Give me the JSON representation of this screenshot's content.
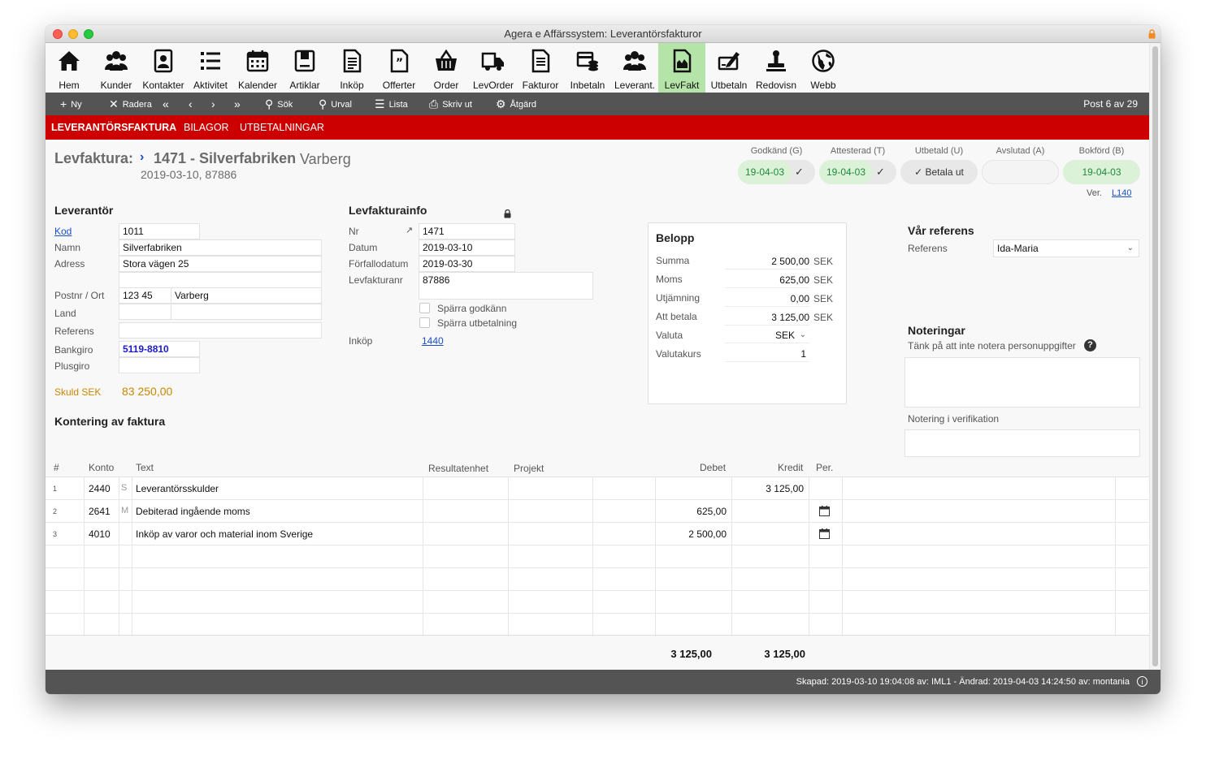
{
  "window": {
    "title": "Agera e Affärssystem: Leverantörsfakturor"
  },
  "toolbar": {
    "items": [
      {
        "label": "Hem",
        "icon": "home-icon"
      },
      {
        "label": "Kunder",
        "icon": "customers-icon"
      },
      {
        "label": "Kontakter",
        "icon": "contacts-icon"
      },
      {
        "label": "Aktivitet",
        "icon": "activity-list-icon"
      },
      {
        "label": "Kalender",
        "icon": "calendar-icon"
      },
      {
        "label": "Artiklar",
        "icon": "articles-icon"
      },
      {
        "label": "Inköp",
        "icon": "purchase-icon"
      },
      {
        "label": "Offerter",
        "icon": "quotes-icon"
      },
      {
        "label": "Order",
        "icon": "basket-icon"
      },
      {
        "label": "LevOrder",
        "icon": "truck-icon"
      },
      {
        "label": "Fakturor",
        "icon": "invoices-icon"
      },
      {
        "label": "Inbetaln",
        "icon": "incoming-payment-icon"
      },
      {
        "label": "Leverant.",
        "icon": "suppliers-icon"
      },
      {
        "label": "LevFakt",
        "icon": "supplier-invoice-icon"
      },
      {
        "label": "Utbetaln",
        "icon": "outgoing-payment-icon"
      },
      {
        "label": "Redovisn",
        "icon": "stamp-icon"
      },
      {
        "label": "Webb",
        "icon": "globe-icon"
      }
    ],
    "active": "LevFakt",
    "active_color": "#b5e4a8"
  },
  "actions": {
    "new": "Ny",
    "delete": "Radera",
    "search": "Sök",
    "filter": "Urval",
    "list": "Lista",
    "print": "Skriv ut",
    "action": "Åtgärd",
    "post_counter": "Post 6 av 29"
  },
  "tabs": [
    "LEVERANTÖRSFAKTURA",
    "BILAGOR",
    "UTBETALNINGAR"
  ],
  "tab_color": "#cc0000",
  "header": {
    "label": "Levfaktura:",
    "chevron": "›",
    "number_name": "1471 - Silverfabriken",
    "city": "Varberg",
    "subline": "2019-03-10, 87886"
  },
  "status": {
    "approved": {
      "label": "Godkänd (G)",
      "date": "19-04-03"
    },
    "attested": {
      "label": "Attesterad (T)",
      "date": "19-04-03"
    },
    "paid": {
      "label": "Utbetald (U)",
      "button": "Betala ut"
    },
    "closed": {
      "label": "Avslutad (A)",
      "value": ""
    },
    "booked": {
      "label": "Bokförd (B)",
      "date": "19-04-03"
    },
    "ver_label": "Ver.",
    "ver_link": "L140",
    "green": "#dcf2d8"
  },
  "supplier": {
    "title": "Leverantör",
    "code_label": "Kod",
    "code": "1011",
    "name_label": "Namn",
    "name": "Silverfabriken",
    "address_label": "Adress",
    "address1": "Stora vägen 25",
    "address2": "",
    "postal_label": "Postnr / Ort",
    "postal": "123 45",
    "city": "Varberg",
    "country_label": "Land",
    "country": "",
    "country2": "",
    "reference_label": "Referens",
    "reference": "",
    "bankgiro_label": "Bankgiro",
    "bankgiro": "5119-8810",
    "plusgiro_label": "Plusgiro",
    "plusgiro": "",
    "debt_label": "Skuld SEK",
    "debt": "83 250,00"
  },
  "invoiceinfo": {
    "title": "Levfakturainfo",
    "nr_label": "Nr",
    "nr": "1471",
    "date_label": "Datum",
    "date": "2019-03-10",
    "due_label": "Förfallodatum",
    "due": "2019-03-30",
    "invno_label": "Levfakturanr",
    "invno": "87886",
    "block_approve": "Spärra godkänn",
    "block_payment": "Spärra utbetalning",
    "purchase_label": "Inköp",
    "purchase": "1440"
  },
  "amount": {
    "title": "Belopp",
    "sum_label": "Summa",
    "sum": "2 500,00",
    "vat_label": "Moms",
    "vat": "625,00",
    "rounding_label": "Utjämning",
    "rounding": "0,00",
    "topay_label": "Att betala",
    "topay": "3 125,00",
    "currency_unit": "SEK",
    "currency_label": "Valuta",
    "currency": "SEK",
    "rate_label": "Valutakurs",
    "rate": "1"
  },
  "our_reference": {
    "title": "Vår referens",
    "ref_label": "Referens",
    "ref": "Ida-Maria"
  },
  "notes": {
    "title": "Noteringar",
    "hint": "Tänk på att inte notera personuppgifter",
    "notes_text": "",
    "verif_label": "Notering i verifikation",
    "verif_text": ""
  },
  "booking": {
    "title": "Kontering av faktura",
    "headers": {
      "num": "#",
      "account": "Konto",
      "text": "Text",
      "unit": "Resultatenhet",
      "project": "Projekt",
      "debit": "Debet",
      "credit": "Kredit",
      "per": "Per."
    },
    "rows": [
      {
        "num": "1",
        "account": "2440",
        "flag": "S",
        "text": "Leverantörsskulder",
        "debit": "",
        "credit": "3 125,00",
        "period_icon": false
      },
      {
        "num": "2",
        "account": "2641",
        "flag": "M",
        "text": "Debiterad ingående moms",
        "debit": "625,00",
        "credit": "",
        "period_icon": true
      },
      {
        "num": "3",
        "account": "4010",
        "flag": "",
        "text": "Inköp av varor och material inom Sverige",
        "debit": "2 500,00",
        "credit": "",
        "period_icon": true
      }
    ],
    "total_debit": "3 125,00",
    "total_credit": "3 125,00"
  },
  "footer": {
    "text": "Skapad: 2019-03-10 19:04:08 av: IML1 - Ändrad: 2019-04-03 14:24:50 av: montania"
  }
}
